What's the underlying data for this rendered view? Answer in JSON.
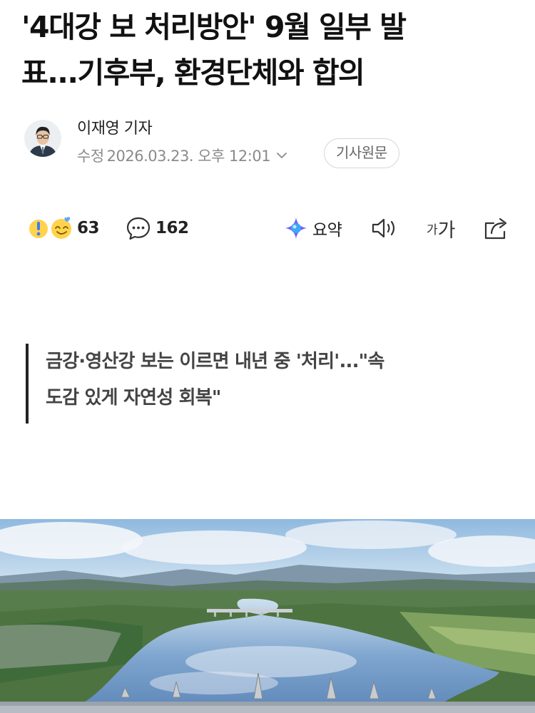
{
  "article": {
    "headline_line1": "'4대강 보 처리방안' 9월 일부 발",
    "headline_line2": "표...기후부, 환경단체와 합의",
    "reporter": "이재영 기자",
    "modified_label": "수정",
    "modified_time": "2026.03.23. 오후 12:01",
    "original_button": "기사원문",
    "subtitle_line1": "금강·영산강 보는 이르면 내년 중 '처리'...\"속",
    "subtitle_line2": "도감 있게 자연성 회복\""
  },
  "toolbar": {
    "reaction_count": "63",
    "comment_count": "162",
    "summary_label": "요약",
    "font_small": "가",
    "font_big": "가"
  },
  "colors": {
    "text_primary": "#111111",
    "text_muted": "#8a8a8a",
    "summary_icon_purple": "#6f5cf6",
    "summary_icon_blue": "#3fa7f5"
  },
  "icons": {
    "reactions": "reaction-emoji-icon",
    "comments": "speech-bubble-icon",
    "summary": "sparkle-icon",
    "listen": "speaker-icon",
    "share": "share-icon",
    "expand": "chevron-down-icon"
  }
}
